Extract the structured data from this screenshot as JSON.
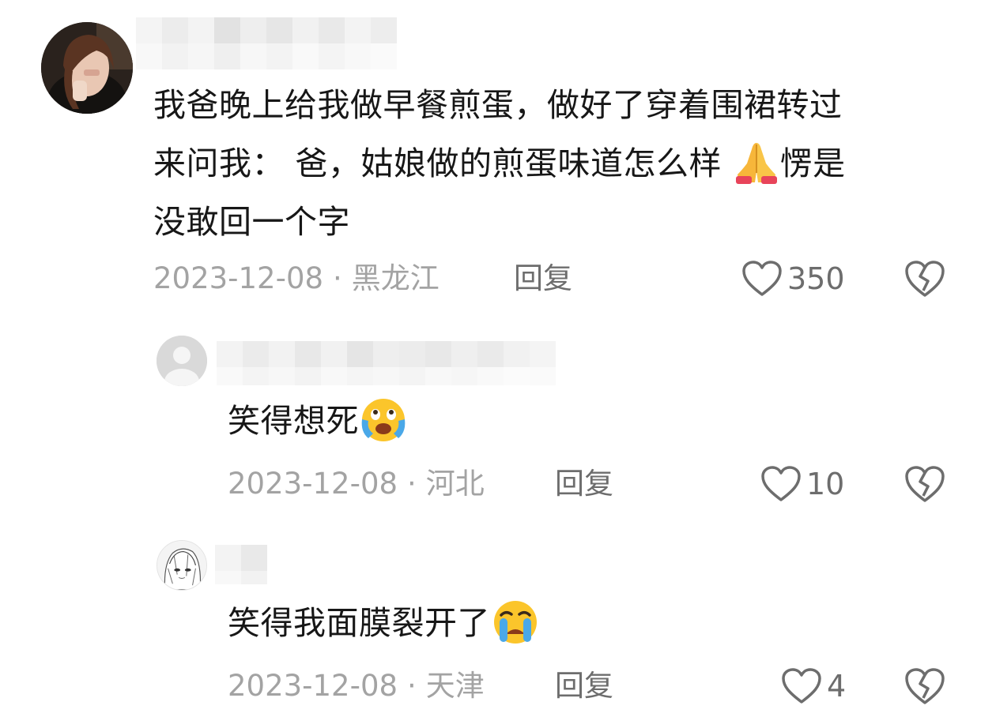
{
  "comments": [
    {
      "text_lines": [
        "我爸晚上给我做早餐煎蛋，做好了穿着围裙转过",
        "来问我： 爸，姑娘做的煎蛋味道怎么样",
        "没敢回一个字"
      ],
      "inline_text_after_emoji": "愣是",
      "emoji": "folded-hands-emoji",
      "date": "2023-12-08",
      "separator": "·",
      "location": "黑龙江",
      "reply_label": "回复",
      "likes": "350"
    },
    {
      "text_lines": [
        "笑得想死"
      ],
      "emoji": "crying-laughing-emoji",
      "date": "2023-12-08",
      "separator": "·",
      "location": "河北",
      "reply_label": "回复",
      "likes": "10"
    },
    {
      "text_lines": [
        "笑得我面膜裂开了"
      ],
      "emoji": "loudly-crying-emoji",
      "date": "2023-12-08",
      "separator": "·",
      "location": "天津",
      "reply_label": "回复",
      "likes": "4"
    }
  ],
  "icons": {
    "like": "heart-outline-icon",
    "dislike": "broken-heart-icon"
  },
  "colors": {
    "text": "#171717",
    "meta": "#a3a3a3",
    "action": "#6d6d6d"
  }
}
